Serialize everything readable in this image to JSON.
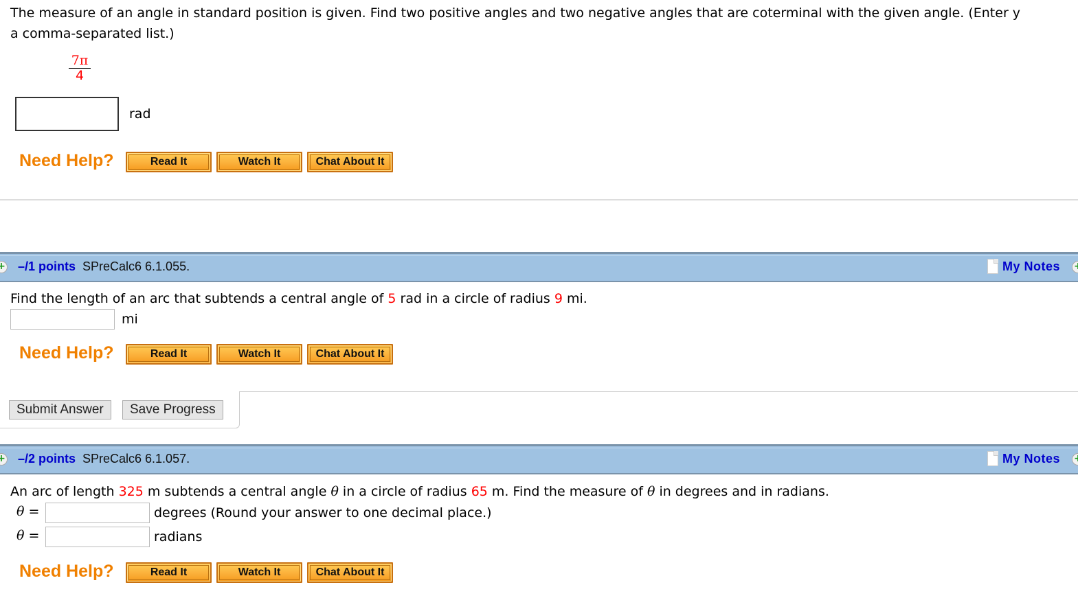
{
  "q1": {
    "prompt_line1": "The measure of an angle in standard position is given. Find two positive angles and two negative angles that are coterminal with the given angle. (Enter y",
    "prompt_line2": "a comma-separated list.)",
    "angle_numerator": "7π",
    "angle_denominator": "4",
    "answer_value": "",
    "unit": "rad",
    "need_help": "Need Help?",
    "help_buttons": [
      "Read It",
      "Watch It",
      "Chat About It"
    ]
  },
  "q2": {
    "points": "–/1 points",
    "id": "SPreCalc6 6.1.055.",
    "my_notes": "My Notes",
    "prompt_parts": [
      "Find the length of an arc that subtends a central angle of ",
      "5",
      " rad in a circle of radius ",
      "9",
      " mi."
    ],
    "answer_value": "",
    "unit": "mi",
    "need_help": "Need Help?",
    "help_buttons": [
      "Read It",
      "Watch It",
      "Chat About It"
    ]
  },
  "submit": {
    "submit_label": "Submit Answer",
    "save_label": "Save Progress"
  },
  "q3": {
    "points": "–/2 points",
    "id": "SPreCalc6 6.1.057.",
    "my_notes": "My Notes",
    "prompt_parts": [
      "An arc of length ",
      "325",
      " m subtends a central angle ",
      "θ",
      " in a circle of radius ",
      "65",
      " m. Find the measure of ",
      "θ",
      " in degrees and in radians."
    ],
    "theta_label": "θ",
    "equals": "=",
    "degrees_value": "",
    "degrees_unit": "degrees (Round your answer to one decimal place.)",
    "radians_value": "",
    "radians_unit": "radians",
    "need_help": "Need Help?",
    "help_buttons": [
      "Read It",
      "Watch It",
      "Chat About It"
    ]
  },
  "colors": {
    "highlight_red": "#ff0000",
    "need_help_orange": "#f08000",
    "points_blue": "#0000cc",
    "question_bar": "#9fc2e2",
    "help_button": "#fbb03b"
  }
}
